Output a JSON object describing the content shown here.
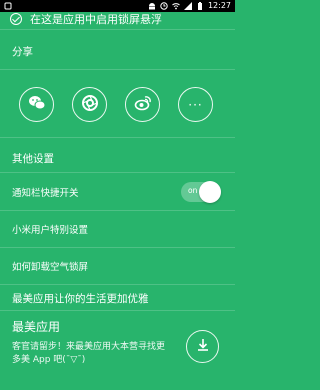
{
  "status_bar": {
    "time": "12:27",
    "icons": [
      "notification-icon",
      "android-icon",
      "clock-icon",
      "wifi-icon",
      "signal-icon",
      "battery-icon"
    ]
  },
  "clipped_row": {
    "label": "在这是应用中启用锁屏悬浮"
  },
  "share": {
    "title": "分享",
    "buttons": [
      {
        "name": "wechat-icon"
      },
      {
        "name": "moments-icon"
      },
      {
        "name": "weibo-icon"
      },
      {
        "name": "more-icon",
        "text": "···"
      }
    ]
  },
  "other_settings": {
    "title": "其他设置",
    "rows": [
      {
        "label": "通知栏快捷开关",
        "toggle": {
          "state_label": "on",
          "checked": true
        }
      },
      {
        "label": "小米用户特别设置"
      },
      {
        "label": "如何卸载空气锁屏"
      }
    ]
  },
  "promo": {
    "title": "最美应用让你的生活更加优雅",
    "app": {
      "name": "最美应用",
      "description": "客官请留步！来最美应用大本营寻找更多美 App 吧(¯▽¯)"
    }
  },
  "colors": {
    "background": "#28b46c",
    "text": "#ffffff",
    "status_bar": "#000000"
  }
}
